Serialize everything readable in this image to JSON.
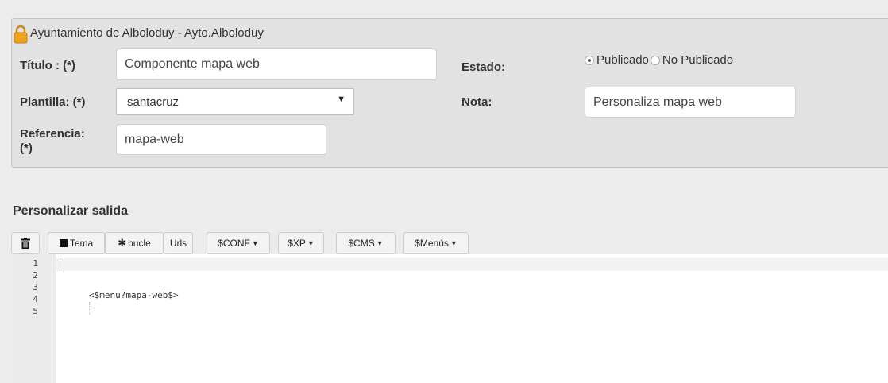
{
  "header": {
    "org_title": "Ayuntamiento de Alboloduy - Ayto.Alboloduy"
  },
  "form": {
    "titulo_label": "Título : (*)",
    "titulo_value": "Componente mapa web",
    "estado_label": "Estado:",
    "estado_options": [
      "Publicado",
      "No Publicado"
    ],
    "estado_selected": "Publicado",
    "plantilla_label": "Plantilla: (*)",
    "plantilla_value": "santacruz",
    "nota_label": "Nota:",
    "nota_value": "Personaliza mapa web",
    "referencia_label_line1": "Referencia:",
    "referencia_label_line2": "(*)",
    "referencia_value": "mapa-web"
  },
  "section": {
    "title": "Personalizar salida"
  },
  "toolbar": {
    "tema": "Tema",
    "bucle": "bucle",
    "urls": "Urls",
    "conf": "$CONF",
    "xp": "$XP",
    "cms": "$CMS",
    "menus": "$Menús"
  },
  "editor": {
    "line_numbers": [
      "1",
      "2",
      "3",
      "4",
      "5"
    ],
    "code_line_3": "<$menu?mapa-web$>"
  },
  "icons": {
    "lock": "lock-icon",
    "trash": "trash-icon",
    "square": "square-icon",
    "asterisk": "asterisk-icon",
    "caret": "caret-down-icon"
  }
}
